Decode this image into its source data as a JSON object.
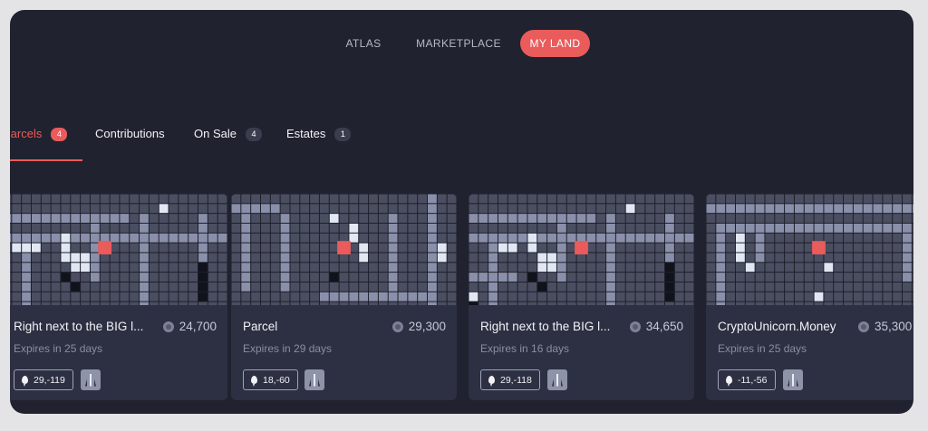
{
  "nav": {
    "items": [
      {
        "label": "ATLAS",
        "active": false
      },
      {
        "label": "MARKETPLACE",
        "active": false
      },
      {
        "label": "MY LAND",
        "active": true
      }
    ]
  },
  "tabs": [
    {
      "label": "Parcels",
      "badge": "4",
      "active": true
    },
    {
      "label": "Contributions",
      "badge": null,
      "active": false
    },
    {
      "label": "On Sale",
      "badge": "4",
      "active": false
    },
    {
      "label": "Estates",
      "badge": "1",
      "active": false
    }
  ],
  "cards": [
    {
      "title": "Right next to the BIG l...",
      "price": "24,700",
      "expires": "Expires in 25 days",
      "coords": "29,-119"
    },
    {
      "title": "Parcel",
      "price": "29,300",
      "expires": "Expires in 29 days",
      "coords": "18,-60"
    },
    {
      "title": "Right next to the BIG l...",
      "price": "34,650",
      "expires": "Expires in 16 days",
      "coords": "29,-118"
    },
    {
      "title": "CryptoUnicorn.Money",
      "price": "35,300",
      "expires": "Expires in 25 days",
      "coords": "-11,-56"
    }
  ],
  "icons": {
    "price": "mana-icon",
    "location": "map-pin-icon",
    "road": "road-icon"
  },
  "colors": {
    "accent": "#ea5b5b",
    "background": "#20222f",
    "card": "#2d3042",
    "parcel": "#4a4e60",
    "road": "#8a90aa",
    "highlight": "#e1e8f4"
  }
}
